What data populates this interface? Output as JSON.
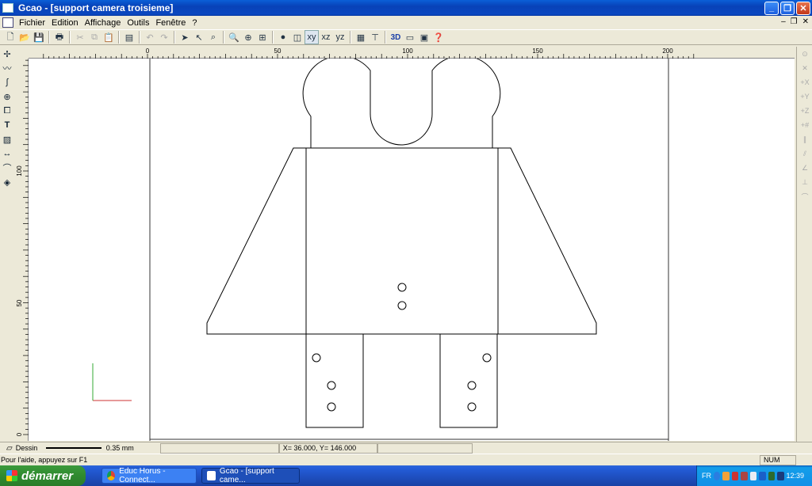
{
  "window": {
    "title": "Gcao - [support camera troisieme]"
  },
  "menu": {
    "items": [
      "Fichier",
      "Edition",
      "Affichage",
      "Outils",
      "Fenêtre",
      "?"
    ]
  },
  "toolbar": {
    "mode_3d_label": "3D"
  },
  "ruler": {
    "h_labels": [
      "0",
      "50",
      "100",
      "150",
      "200"
    ],
    "v_labels": [
      "100",
      "50",
      "0"
    ]
  },
  "properties": {
    "layer": "Dessin",
    "line_width": "0.35 mm",
    "coordinates": "X=    36.000, Y=   146.000"
  },
  "status": {
    "help_text": "Pour l'aide, appuyez sur F1",
    "num": "NUM"
  },
  "taskbar": {
    "start_label": "démarrer",
    "tasks": [
      "Educ Horus - Connect...",
      "Gcao - [support came..."
    ],
    "lang": "FR",
    "clock": "12:39"
  },
  "colors": {
    "titlebar": "#0a47c0",
    "taskbar": "#245edb",
    "start": "#2f8a2f",
    "axis_x": "#cc3333",
    "axis_y": "#33aa33"
  }
}
